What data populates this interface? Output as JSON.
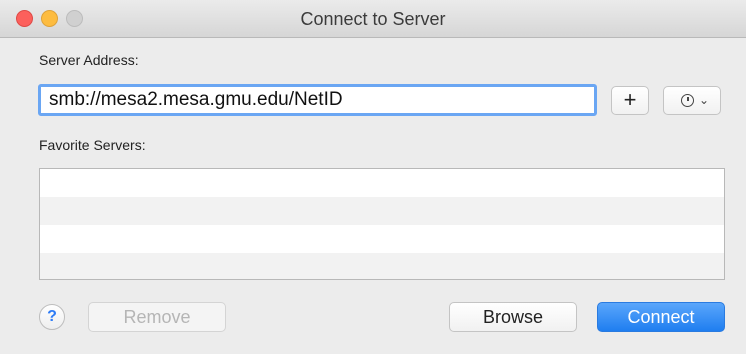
{
  "window": {
    "title": "Connect to Server"
  },
  "server_address": {
    "label": "Server Address:",
    "value": "smb://mesa2.mesa.gmu.edu/NetID"
  },
  "favorites": {
    "label": "Favorite Servers:",
    "items": []
  },
  "toolbar": {
    "add_label": "+",
    "help_label": "?",
    "remove_label": "Remove",
    "browse_label": "Browse",
    "connect_label": "Connect"
  },
  "icons": {
    "recent": "clock-icon",
    "recent_menu": "chevron-down-icon"
  },
  "colors": {
    "accent": "#2e7cf6",
    "close": "#fc605c",
    "minimize": "#fdbc40",
    "zoom": "#d0d0d0"
  }
}
